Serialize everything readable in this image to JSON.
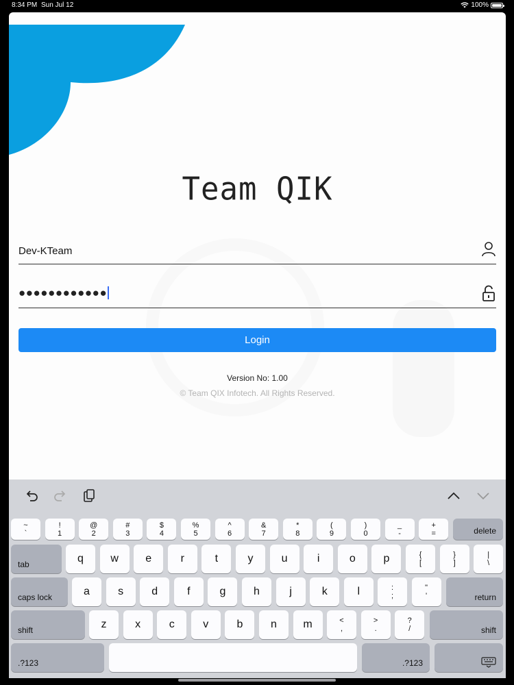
{
  "status": {
    "time": "8:34 PM",
    "date": "Sun Jul 12",
    "battery": "100%"
  },
  "app": {
    "logo": "Team QIK",
    "username": "Dev-KTeam",
    "password_mask": "●●●●●●●●●●●●",
    "login_label": "Login",
    "version": "Version No: 1.00",
    "copyright": "© Team QIX Infotech. All Rights Reserved.",
    "accent": "#1c8af5",
    "brand_blob": "#0a9fe0"
  },
  "keyboard": {
    "num_row": [
      {
        "top": "~",
        "bottom": "`"
      },
      {
        "top": "!",
        "bottom": "1"
      },
      {
        "top": "@",
        "bottom": "2"
      },
      {
        "top": "#",
        "bottom": "3"
      },
      {
        "top": "$",
        "bottom": "4"
      },
      {
        "top": "%",
        "bottom": "5"
      },
      {
        "top": "^",
        "bottom": "6"
      },
      {
        "top": "&",
        "bottom": "7"
      },
      {
        "top": "*",
        "bottom": "8"
      },
      {
        "top": "(",
        "bottom": "9"
      },
      {
        "top": ")",
        "bottom": "0"
      },
      {
        "top": "_",
        "bottom": "-"
      },
      {
        "top": "+",
        "bottom": "="
      }
    ],
    "delete": "delete",
    "tab": "tab",
    "row_q": [
      "q",
      "w",
      "e",
      "r",
      "t",
      "y",
      "u",
      "i",
      "o",
      "p"
    ],
    "row_q_sym": [
      {
        "top": "{",
        "bottom": "["
      },
      {
        "top": "}",
        "bottom": "]"
      },
      {
        "top": "|",
        "bottom": "\\"
      }
    ],
    "caps": "caps lock",
    "row_a": [
      "a",
      "s",
      "d",
      "f",
      "g",
      "h",
      "j",
      "k",
      "l"
    ],
    "row_a_sym": [
      {
        "top": ":",
        "bottom": ";"
      },
      {
        "top": "\"",
        "bottom": "'"
      }
    ],
    "return": "return",
    "shift": "shift",
    "row_z": [
      "z",
      "x",
      "c",
      "v",
      "b",
      "n",
      "m"
    ],
    "row_z_sym": [
      {
        "top": "<",
        "bottom": ","
      },
      {
        "top": ">",
        "bottom": "."
      },
      {
        "top": "?",
        "bottom": "/"
      }
    ],
    "num_toggle": ".?123"
  }
}
